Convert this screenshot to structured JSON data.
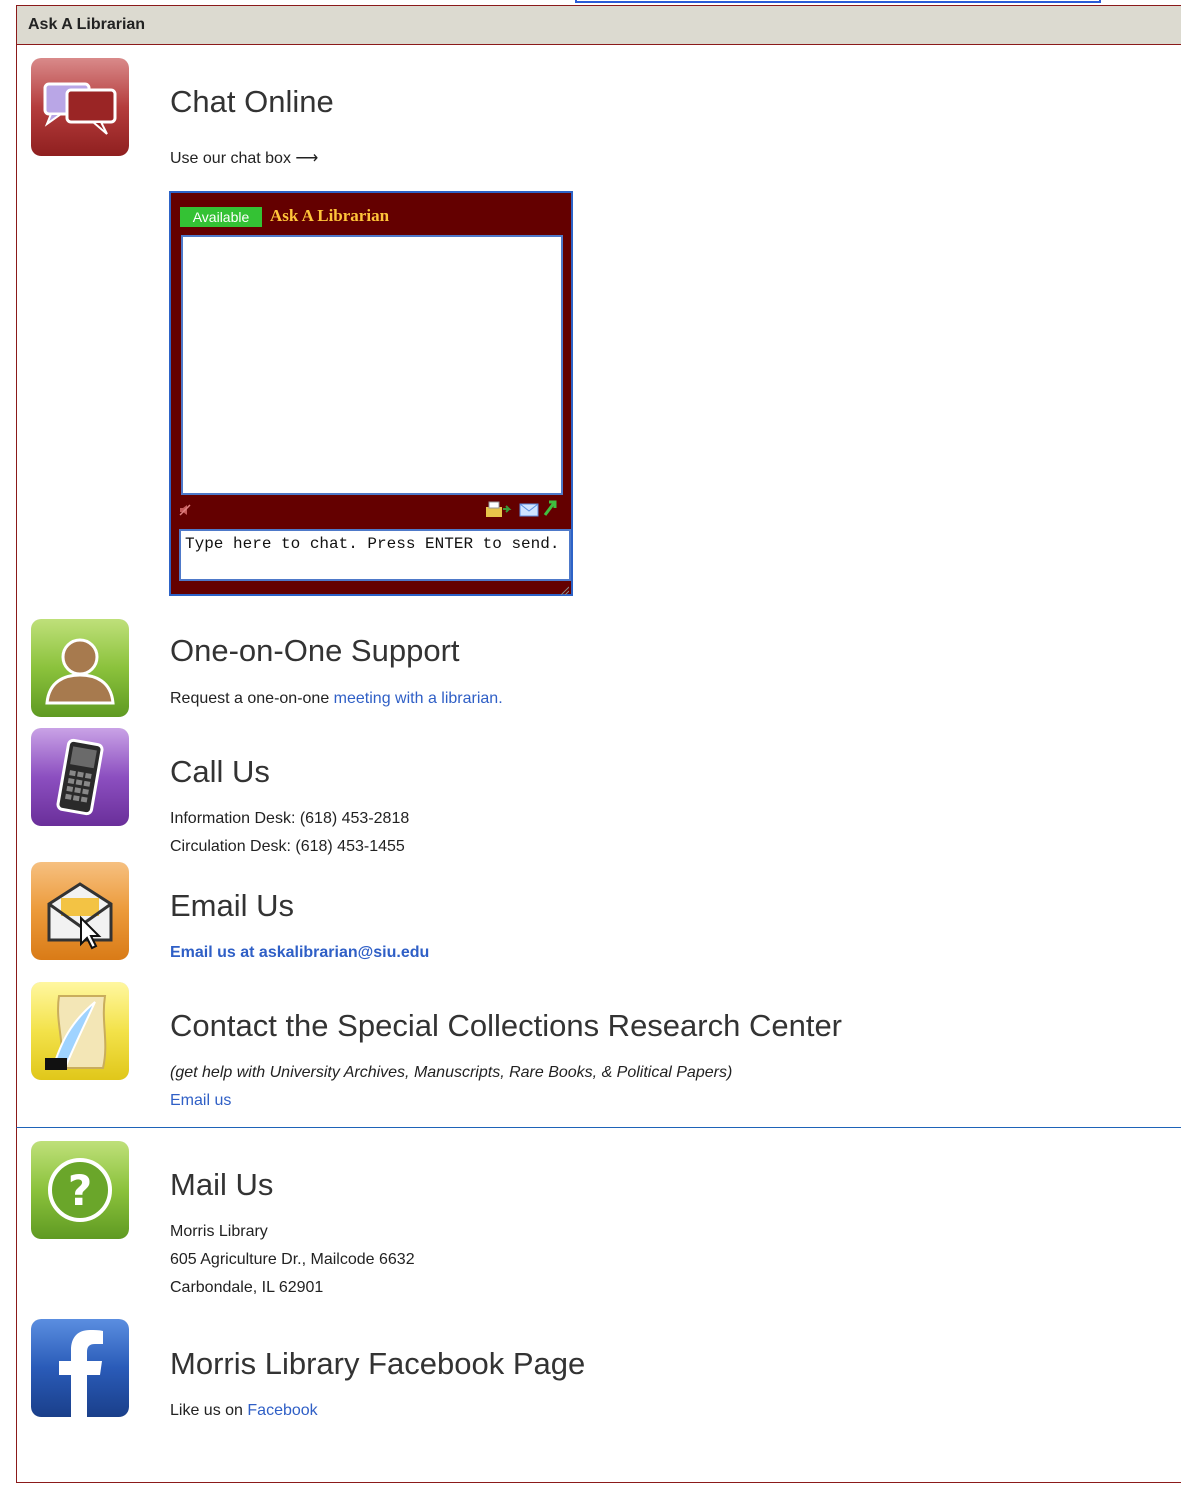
{
  "panel": {
    "header": "Ask A Librarian"
  },
  "chat_online": {
    "title": "Chat Online",
    "text": "Use our chat box ⟶",
    "widget": {
      "status": "Available",
      "title": "Ask A Librarian",
      "input_placeholder": "Type here to chat. Press ENTER to send."
    }
  },
  "one_on_one": {
    "title": "One-on-One Support",
    "text_prefix": "Request a one-on-one ",
    "link": "meeting with a librarian."
  },
  "call_us": {
    "title": "Call Us",
    "line1": "Information Desk: (618) 453-2818",
    "line2": "Circulation Desk: (618) 453-1455"
  },
  "email_us": {
    "title": "Email Us",
    "link": "Email us at askalibrarian@siu.edu"
  },
  "special_collections": {
    "title": "Contact the Special Collections Research Center",
    "note": "(get help with University Archives, Manuscripts, Rare Books, & Political Papers)",
    "link": "Email us"
  },
  "mail_us": {
    "title": "Mail Us",
    "line1": "Morris Library",
    "line2": "605 Agriculture Dr., Mailcode 6632",
    "line3": "Carbondale, IL 62901"
  },
  "facebook": {
    "title": "Morris Library Facebook Page",
    "text_prefix": "Like us on ",
    "link": "Facebook"
  },
  "colors": {
    "chat_bg": "#640000",
    "available_green": "#34c234",
    "chat_title_gold": "#ffc53a",
    "link_blue": "#2f5fc6",
    "header_bg": "#dcdad0",
    "border_maroon": "#8b1a1a"
  },
  "icons": [
    "chat-bubbles-icon",
    "person-icon",
    "phone-icon",
    "envelope-icon",
    "scroll-quill-icon",
    "question-icon",
    "facebook-icon",
    "speaker-mute-icon",
    "print-icon",
    "email-transcript-icon",
    "popout-icon"
  ]
}
